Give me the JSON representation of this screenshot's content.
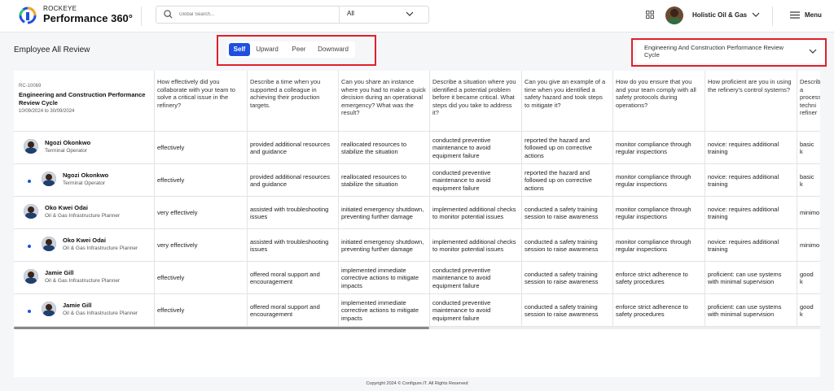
{
  "header": {
    "brand_top": "ROCKEYE",
    "brand_main": "Performance 360°",
    "search_placeholder": "Global Search...",
    "search_scope": "All",
    "company": "Holistic Oil & Gas",
    "menu_label": "Menu"
  },
  "page": {
    "title": "Employee All Review",
    "tabs": [
      {
        "label": "Self",
        "active": true
      },
      {
        "label": "Upward",
        "active": false
      },
      {
        "label": "Peer",
        "active": false
      },
      {
        "label": "Downward",
        "active": false
      }
    ],
    "cycle_select": "Engineering And Construction Performance Review Cycle"
  },
  "review": {
    "id": "RC-10069",
    "title": "Engineering and Construction Performance Review Cycle",
    "dates": "10/09/2024 to 30/09/2024"
  },
  "questions": [
    "How effectively did you collaborate with your team to solve a critical issue in the refinery?",
    "Describe a time when you supported a colleague in achieving their production targets.",
    "Can you share an instance where you had to make a quick decision during an operational emergency? What was the result?",
    "Describe a situation where you identified a potential problem before it became critical. What steps did you take to address it?",
    "Can you give an example of a time when you identified a safety hazard and took steps to mitigate it?",
    "How do you ensure that you and your team comply with all safety protocols during operations?",
    "How proficient are you in using the refinery's control systems?",
    "Describe a process techni refiner"
  ],
  "rows": [
    {
      "name": "Ngozi Okonkwo",
      "role": "Terminal Operator",
      "sub": false,
      "answers": [
        "effectively",
        "provided additional resources and guidance",
        "reallocated resources to stabilize the situation",
        "conducted preventive maintenance to avoid equipment failure",
        "reported the hazard and followed up on corrective actions",
        "monitor compliance through regular inspections",
        "novice: requires additional training",
        "basic k"
      ]
    },
    {
      "name": "Ngozi Okonkwo",
      "role": "Terminal Operator",
      "sub": true,
      "answers": [
        "effectively",
        "provided additional resources and guidance",
        "reallocated resources to stabilize the situation",
        "conducted preventive maintenance to avoid equipment failure",
        "reported the hazard and followed up on corrective actions",
        "monitor compliance through regular inspections",
        "novice: requires additional training",
        "basic k"
      ]
    },
    {
      "name": "Oko Kwei Odai",
      "role": "Oil & Gas Infrastructure Planner",
      "sub": false,
      "answers": [
        "very effectively",
        "assisted with troubleshooting issues",
        "initiated emergency shutdown, preventing further damage",
        "implemented additional checks to monitor potential issues",
        "conducted a safety training session to raise awareness",
        "monitor compliance through regular inspections",
        "novice: requires additional training",
        "minimo"
      ]
    },
    {
      "name": "Oko Kwei Odai",
      "role": "Oil & Gas Infrastructure Planner",
      "sub": true,
      "answers": [
        "very effectively",
        "assisted with troubleshooting issues",
        "initiated emergency shutdown, preventing further damage",
        "implemented additional checks to monitor potential issues",
        "conducted a safety training session to raise awareness",
        "monitor compliance through regular inspections",
        "novice: requires additional training",
        "minimo"
      ]
    },
    {
      "name": "Jamie Gill",
      "role": "Oil & Gas Infrastructure Planner",
      "sub": false,
      "answers": [
        "effectively",
        "offered moral support and encouragement",
        "implemented immediate corrective actions to mitigate impacts",
        "conducted preventive maintenance to avoid equipment failure",
        "conducted a safety training session to raise awareness",
        "enforce strict adherence to safety procedures",
        "proficient: can use systems with minimal supervision",
        "good k"
      ]
    },
    {
      "name": "Jamie Gill",
      "role": "Oil & Gas Infrastructure Planner",
      "sub": true,
      "answers": [
        "effectively",
        "offered moral support and encouragement",
        "implemented immediate corrective actions to mitigate impacts",
        "conducted preventive maintenance to avoid equipment failure",
        "conducted a safety training session to raise awareness",
        "enforce strict adherence to safety procedures",
        "proficient: can use systems with minimal supervision",
        "good k"
      ]
    }
  ],
  "footer": "Copyright 2024 © Configure.IT. All Rights Reserved",
  "colors": {
    "accent": "#1e4fe0",
    "highlight": "#e0202a"
  }
}
